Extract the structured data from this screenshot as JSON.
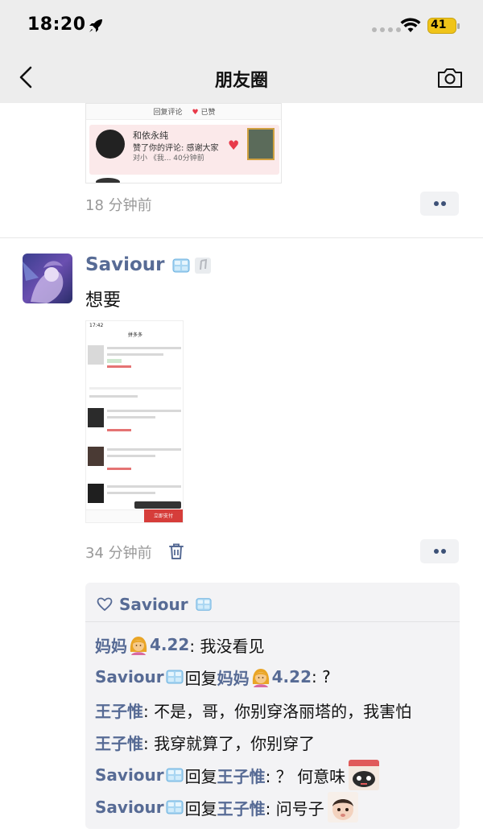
{
  "status_bar": {
    "time": "18:20",
    "battery": "41"
  },
  "nav": {
    "title": "朋友圈"
  },
  "prev_post": {
    "screenshot": {
      "action_reply": "回复评论",
      "action_liked": "已赞",
      "commenter_name": "和依永纯",
      "comment_text": "赞了你的评论: 感谢大家",
      "quote_line": "对小 《我...  40分钟前"
    },
    "time_ago": "18 分钟前"
  },
  "post": {
    "author": "Saviour",
    "content": "想要",
    "time_ago": "34 分钟前",
    "image": {
      "store": "拼多多",
      "buy_button": "立即支付"
    },
    "likes": [
      "Saviour"
    ],
    "comments": [
      {
        "name": "妈妈",
        "name_suffix": "4.22",
        "text": ": 我没看见"
      },
      {
        "name": "Saviour",
        "reply_word": "回复",
        "reply_to": "妈妈",
        "reply_to_suffix": "4.22",
        "text": ": ?"
      },
      {
        "name": "王子惟",
        "text": ": 不是，哥，你别穿洛丽塔的，我害怕"
      },
      {
        "name": "王子惟",
        "text": ": 我穿就算了，你别穿了"
      },
      {
        "name": "Saviour",
        "reply_word": "回复",
        "reply_to": "王子惟",
        "text": ": ？ 何意味"
      },
      {
        "name": "Saviour",
        "reply_word": "回复",
        "reply_to": "王子惟",
        "text": ": 问号子"
      }
    ]
  },
  "colors": {
    "link_blue": "#576b95",
    "nav_bg": "#ededed",
    "comment_bg": "#f3f3f5"
  },
  "icons": [
    "rocket-icon",
    "wifi-icon",
    "back-arrow-icon",
    "camera-icon",
    "ice-cube-icon",
    "music-badge-icon",
    "trash-icon",
    "heart-outline-icon",
    "more-dots-icon"
  ]
}
